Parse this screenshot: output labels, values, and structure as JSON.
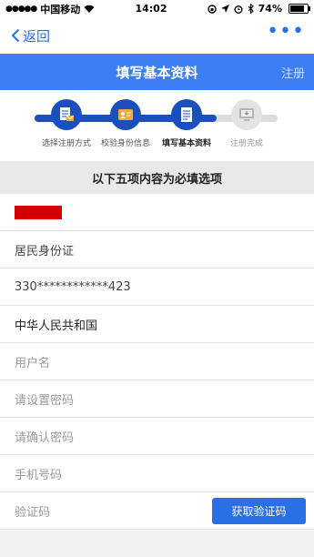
{
  "status_bar": {
    "carrier": "中国移动",
    "time": "14:02",
    "battery": "74%"
  },
  "nav": {
    "back_label": "返回",
    "more_label": "•••"
  },
  "header": {
    "title": "填写基本资料",
    "register_label": "注册"
  },
  "steps": {
    "progress": 0.75,
    "items": [
      {
        "label": "选择注册方式",
        "state": "done",
        "icon": "document-mail-icon"
      },
      {
        "label": "校验身份信息",
        "state": "done",
        "icon": "id-card-icon"
      },
      {
        "label": "填写基本资料",
        "state": "current",
        "icon": "form-icon"
      },
      {
        "label": "注册完成",
        "state": "pending",
        "icon": "monitor-icon"
      }
    ]
  },
  "notice": "以下五项内容为必填选项",
  "form": {
    "id_type": "居民身份证",
    "id_number": "330************423",
    "nationality": "中华人民共和国",
    "username_placeholder": "用户名",
    "password_placeholder": "请设置密码",
    "confirm_placeholder": "请确认密码",
    "phone_placeholder": "手机号码",
    "code_placeholder": "验证码",
    "get_code_label": "获取验证码"
  },
  "colors": {
    "primary": "#3d7ef5",
    "step_active": "#1a4fbd",
    "button": "#2b6fe6",
    "redaction": "#d40000"
  }
}
